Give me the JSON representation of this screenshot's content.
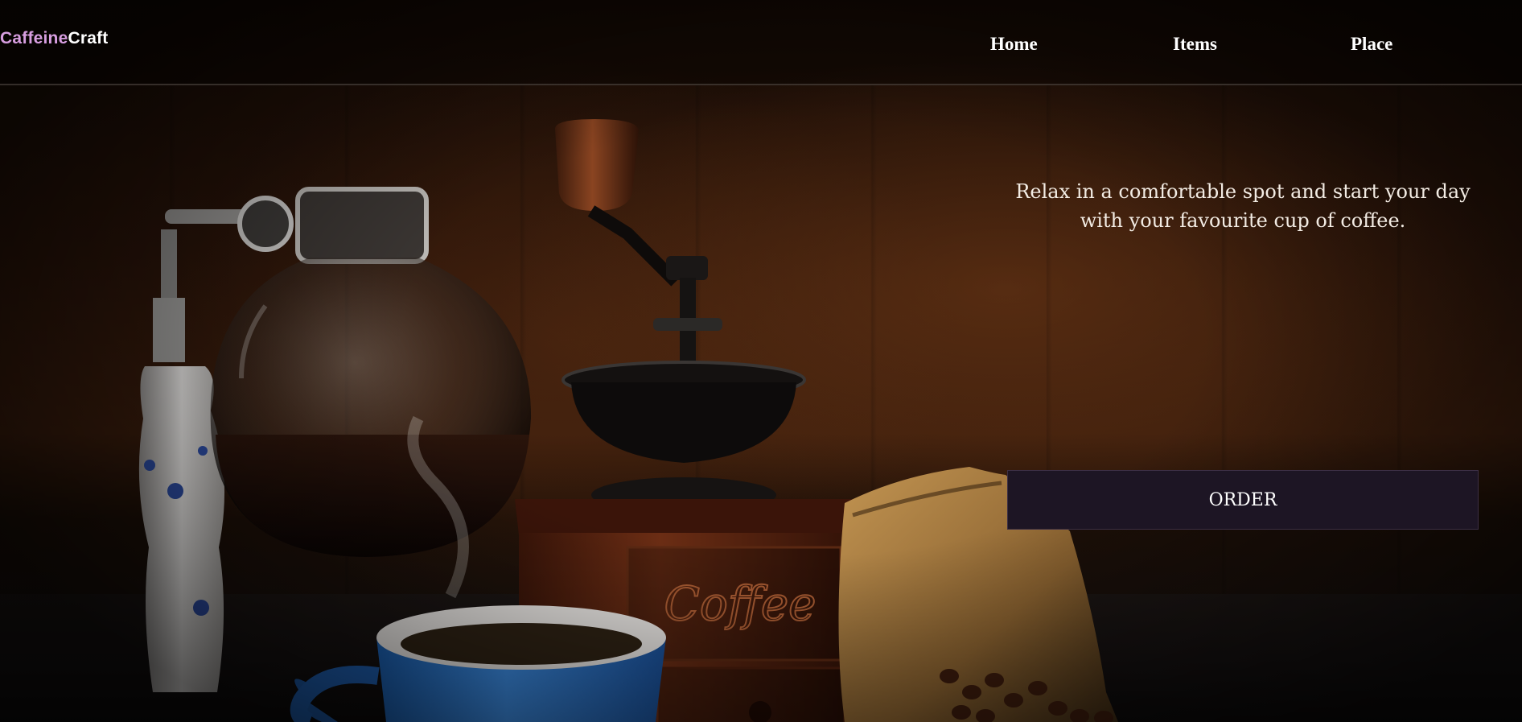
{
  "brand": {
    "part1": "Caffeine",
    "part2": "Craft",
    "colors": {
      "part1": "#d79ee0",
      "part2": "#ffffff"
    }
  },
  "nav": {
    "items": [
      {
        "label": "Home"
      },
      {
        "label": "Items"
      },
      {
        "label": "Place"
      }
    ]
  },
  "hero": {
    "tagline": "Relax in a comfortable spot and start your day with your favourite cup of coffee.",
    "order_label": "ORDER",
    "grinder_text": "Coffee",
    "colors": {
      "button_bg": "#1d1524",
      "text": "#f3ece4"
    }
  }
}
